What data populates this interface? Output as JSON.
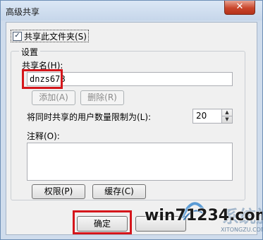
{
  "window": {
    "title": "高级共享",
    "close_label": "✕"
  },
  "share_checkbox": {
    "label": "共享此文件夹(S)",
    "checked": true
  },
  "settings": {
    "legend": "设置",
    "share_name_label": "共享名(H):",
    "share_name_value": "dnzs678",
    "add_button": "添加(A)",
    "remove_button": "删除(R)",
    "limit_label": "将同时共享的用户数量限制为(L):",
    "limit_value": "20",
    "comment_label": "注释(O):",
    "comment_value": "",
    "permissions_button": "权限(P)",
    "cache_button": "缓存(C)"
  },
  "footer": {
    "ok_button": "确定"
  },
  "watermark": {
    "text": "win71234.com",
    "chinese": "系统族",
    "domain": "XITONGZU.COM"
  },
  "highlight_color": "#d5161b"
}
